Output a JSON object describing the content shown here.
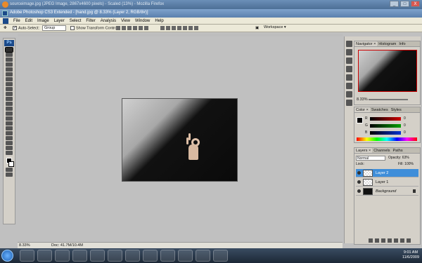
{
  "browser": {
    "title": "sourceimage.jpg (JPEG Image, 2867x4600 pixels) - Scaled (13%) - Mozilla Firefox",
    "controls": [
      "_",
      "□",
      "X"
    ]
  },
  "photoshop": {
    "title": "Adobe Photoshop CS3 Extended - [hand.jpg @ 8.33% (Layer 2, RGB/8#)]"
  },
  "menu": [
    "File",
    "Edit",
    "Image",
    "Layer",
    "Select",
    "Filter",
    "Analysis",
    "View",
    "Window",
    "Help"
  ],
  "options": {
    "auto_select_label": "Auto-Select:",
    "auto_select_value": "Group",
    "show_transform_label": "Show Transform Controls",
    "workspace_label": "Workspace ▾"
  },
  "status": {
    "zoom": "8.33%",
    "doc": "Doc: 41.7M/10.4M"
  },
  "navigator": {
    "tabs": [
      "Navigator ×",
      "Histogram",
      "Info"
    ],
    "zoom": "8.33%"
  },
  "color_panel": {
    "tabs": [
      "Color ×",
      "Swatches",
      "Styles"
    ],
    "channels": [
      {
        "label": "R",
        "value": "0",
        "color": "#d00000"
      },
      {
        "label": "G",
        "value": "0",
        "color": "#00a000"
      },
      {
        "label": "B",
        "value": "0",
        "color": "#0030d0"
      }
    ]
  },
  "layers_panel": {
    "tabs": [
      "Layers ×",
      "Channels",
      "Paths"
    ],
    "blend_mode": "Normal",
    "opacity": "Opacity: 63%",
    "lock": "Lock:",
    "fill": "Fill: 100%",
    "layers": [
      {
        "name": "Layer 2",
        "active": true
      },
      {
        "name": "Layer 1",
        "active": false
      },
      {
        "name": "Background",
        "active": false
      }
    ]
  },
  "tray": {
    "time": "9:01 AM",
    "date": "11/6/2009"
  }
}
